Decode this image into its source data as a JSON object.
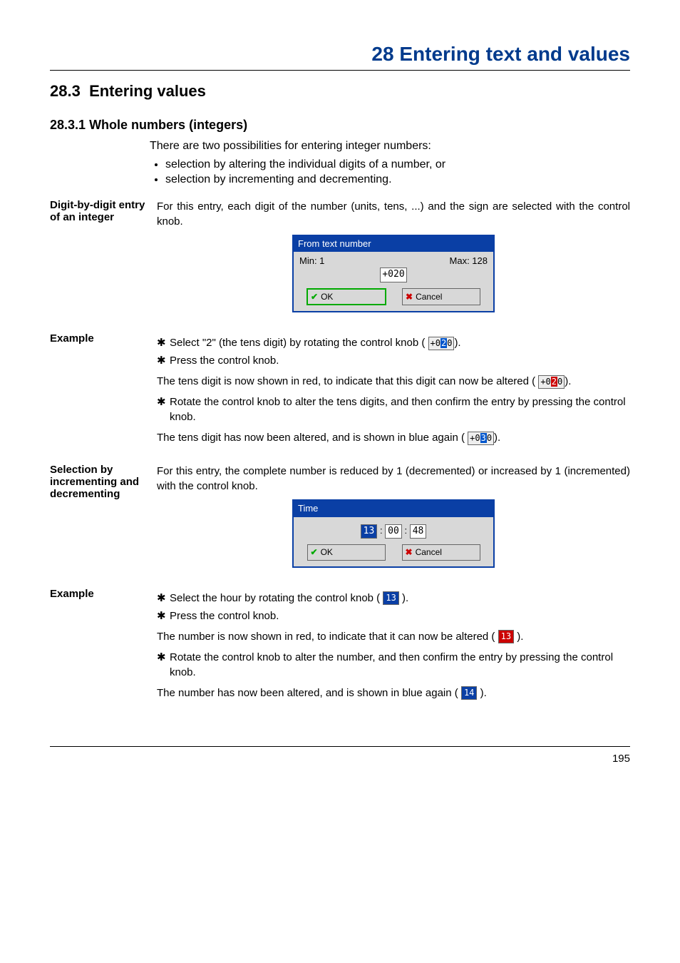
{
  "header": {
    "title": "28 Entering text and values"
  },
  "section": {
    "num": "28.3",
    "title": "Entering values"
  },
  "subsection": {
    "num": "28.3.1",
    "title": "Whole numbers (integers)"
  },
  "intro": "There are two possibilities for entering integer numbers:",
  "intro_bullets": [
    "selection by altering the individual digits of a number, or",
    "selection by incrementing and decrementing."
  ],
  "blockA": {
    "side": "Digit-by-digit entry of an integer",
    "text": "For this entry, each digit of the number (units, tens, ...) and the sign are selected with the control knob."
  },
  "dialogA": {
    "title": "From text number",
    "min_label": "Min: 1",
    "max_label": "Max: 128",
    "num": "+020",
    "ok": "OK",
    "cancel": "Cancel"
  },
  "example1": {
    "side": "Example",
    "steps1_a": "Select \"2\" (the tens digit) by rotating the control knob (",
    "steps1_chip_pre": "+0",
    "steps1_chip_hl": "2",
    "steps1_chip_post": "0",
    "steps1_b": ").",
    "steps2": "Press the control knob.",
    "para1_a": "The tens digit is now shown in red, to indicate that this digit can now be altered (",
    "para1_chip_pre": "+0",
    "para1_chip_hl": "2",
    "para1_chip_post": "0",
    "para1_b": ").",
    "steps3": "Rotate the control knob to alter the tens digits, and then confirm the entry by pressing the control knob.",
    "para2_a": "The tens digit has now been altered, and is shown in blue again (",
    "para2_chip_pre": "+0",
    "para2_chip_hl": "3",
    "para2_chip_post": "0",
    "para2_b": ")."
  },
  "blockB": {
    "side": "Selection by incrementing and decrementing",
    "text": "For this entry, the complete number is reduced by 1 (decremented) or increased by 1 (incremented) with the control knob."
  },
  "dialogB": {
    "title": "Time",
    "hh": "13",
    "mm": "00",
    "ss": "48",
    "ok": "OK",
    "cancel": "Cancel"
  },
  "example2": {
    "side": "Example",
    "steps1_a": "Select the hour by rotating the control knob (",
    "steps1_chip": "13",
    "steps1_b": ").",
    "steps2": "Press the control knob.",
    "para1_a": "The number is now shown in red, to indicate that it can now be altered (",
    "para1_chip": "13",
    "para1_b": ").",
    "steps3": "Rotate the control knob to alter the number, and then confirm the entry by pressing the control knob.",
    "para2_a": "The number has now been altered, and is shown in blue again (",
    "para2_chip": "14",
    "para2_b": ")."
  },
  "footer": {
    "page": "195"
  }
}
